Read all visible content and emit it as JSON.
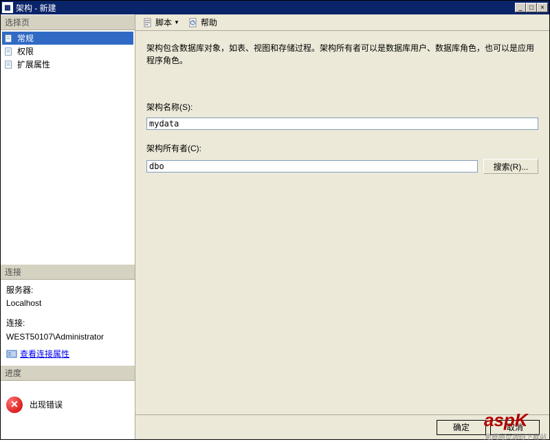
{
  "window": {
    "title": "架构 - 新建"
  },
  "titlebar_buttons": {
    "min": "_",
    "max": "□",
    "close": "×"
  },
  "sidebar": {
    "select_page_header": "选择页",
    "items": [
      {
        "label": "常规",
        "selected": true
      },
      {
        "label": "权限",
        "selected": false
      },
      {
        "label": "扩展属性",
        "selected": false
      }
    ],
    "connection_header": "连接",
    "server_label": "服务器:",
    "server_value": "Localhost",
    "conn_label": "连接:",
    "conn_value": "WEST50107\\Administrator",
    "view_conn_props": "查看连接属性",
    "progress_header": "进度",
    "error_text": "出现错误"
  },
  "toolbar": {
    "script_label": "脚本",
    "help_label": "帮助"
  },
  "main": {
    "description": "架构包含数据库对象，如表、视图和存储过程。架构所有者可以是数据库用户、数据库角色，也可以是应用程序角色。",
    "schema_name_label": "架构名称(S):",
    "schema_name_value": "mydata",
    "schema_owner_label": "架构所有者(C):",
    "schema_owner_value": "dbo",
    "search_button": "搜索(R)..."
  },
  "footer": {
    "ok": "确定",
    "cancel": "取消"
  },
  "watermark": {
    "main": "aspK",
    "sub": "免费网页源码下载站"
  }
}
